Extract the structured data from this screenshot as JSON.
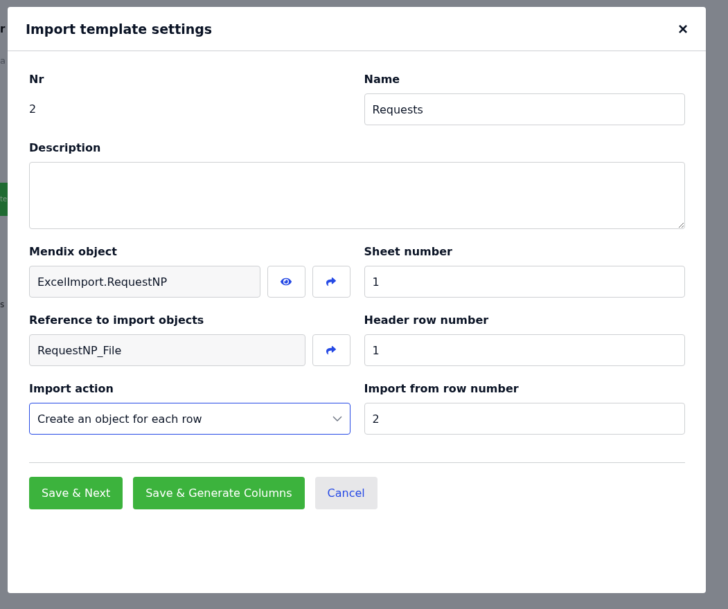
{
  "background": {
    "fragments": [
      {
        "kind": "heading",
        "text": "r"
      },
      {
        "kind": "subtitle",
        "text": "a"
      },
      {
        "kind": "button",
        "text": "te"
      },
      {
        "kind": "text",
        "text": "s"
      }
    ]
  },
  "dialog": {
    "title": "Import template settings",
    "close": "×",
    "fields": [
      {
        "kind": "static",
        "label": "Nr",
        "value": "2"
      },
      {
        "kind": "text",
        "label": "Name",
        "value": "Requests"
      },
      {
        "kind": "textarea",
        "label": "Description"
      },
      {
        "kind": "readonly",
        "label": "Mendix object",
        "value": "ExcelImport.RequestNP",
        "actions": [
          {
            "kind": "view"
          },
          {
            "kind": "open"
          }
        ]
      },
      {
        "kind": "text",
        "label": "Sheet number",
        "value": "1"
      },
      {
        "kind": "readonly",
        "label": "Reference to import objects",
        "value": "RequestNP_File",
        "actions": [
          {
            "kind": "open"
          }
        ]
      },
      {
        "kind": "text",
        "label": "Header row number",
        "value": "1"
      },
      {
        "kind": "select",
        "label": "Import action",
        "value": "Create an object for each row",
        "focused": true
      },
      {
        "kind": "text",
        "label": "Import from row number",
        "value": "2"
      }
    ],
    "buttons": [
      {
        "kind": "primary",
        "label": "Save & Next"
      },
      {
        "kind": "primary",
        "label": "Save & Generate Columns"
      },
      {
        "kind": "secondary",
        "label": "Cancel"
      }
    ]
  }
}
